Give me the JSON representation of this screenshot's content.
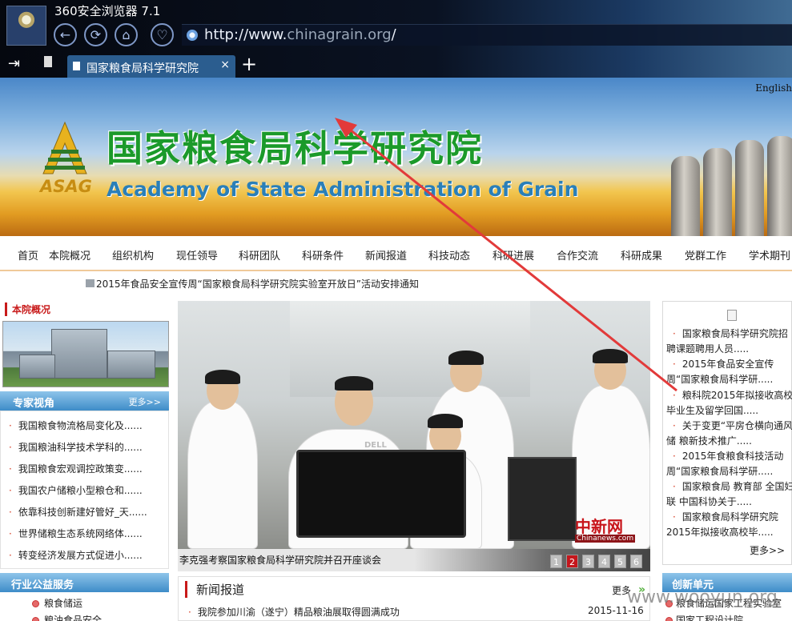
{
  "browser": {
    "app_title": "360安全浏览器 7.1",
    "url_prefix": "http://www.",
    "url_domain": "chinagrain.org",
    "url_suffix": "/",
    "tab_label": "国家粮食局科学研究院",
    "tab_close": "×",
    "new_tab": "+"
  },
  "banner": {
    "english_link": "English",
    "logo_text": "ASAG",
    "title": "国家粮食局科学研究院",
    "subtitle": "Academy of State Administration of Grain"
  },
  "nav": {
    "items": [
      "首页",
      "本院概况",
      "组织机构",
      "现任领导",
      "科研团队",
      "科研条件",
      "新闻报道",
      "科技动态",
      "科研进展",
      "合作交流",
      "科研成果",
      "党群工作",
      "学术期刊"
    ]
  },
  "notice": "2015年食品安全宣传周“国家粮食局科学研究院实验室开放日”活动安排通知",
  "left": {
    "intro_title": "本院概况",
    "experts_title": "专家视角",
    "experts_more": "更多>>",
    "experts": [
      "我国粮食物流格局变化及......",
      "我国粮油科学技术学科的......",
      "我国粮食宏观调控政策变......",
      "我国农户储粮小型粮仓和......",
      "依靠科技创新建好管好_天......",
      "世界储粮生态系统网络体......",
      "转变经济发展方式促进小......"
    ],
    "industry_title": "行业公益服务",
    "industry_items": [
      "粮食储运",
      "粮油食品安全"
    ]
  },
  "slide": {
    "caption": "李克强考察国家粮食局科学研究院并召开座谈会",
    "monitor_brand": "DELL",
    "source_logo": "中新网",
    "source_url": "Chinanews.com",
    "pages": [
      "1",
      "2",
      "3",
      "4",
      "5",
      "6"
    ],
    "active_page": 2
  },
  "news": {
    "title": "新闻报道",
    "more": "更多",
    "more_icon": "»",
    "items": [
      {
        "text": "我院参加川渝（遂宁）精品粮油展取得圆满成功",
        "date": "2015-11-16"
      }
    ]
  },
  "right": {
    "items": [
      "国家粮食局科学研究院招聘课题聘用人员.....",
      "2015年食品安全宣传周“国家粮食局科学研.....",
      "粮科院2015年拟接收高校毕业生及留学回国.....",
      "关于变更“平房仓横向通风储 粮新技术推广.....",
      "2015年食粮食科技活动周“国家粮食局科学研.....",
      "国家粮食局 教育部 全国妇联 中国科协关于.....",
      "国家粮食局科学研究院2015年拟接收高校毕....."
    ],
    "more": "更多>>",
    "innovation_title": "创新单元",
    "innovation_items": [
      "粮食储运国家工程实验室",
      "国家工程设计院"
    ]
  },
  "watermark": "www.wooyun.org",
  "colors": {
    "accent_red": "#c81a1a",
    "banner_green": "#1b9a2a",
    "section_blue": "#3e8cc8",
    "arrow_red": "#e23a3a"
  },
  "icons": [
    "back-icon",
    "refresh-icon",
    "home-icon",
    "heart-icon",
    "globe-icon",
    "document-icon",
    "close-icon",
    "plus-icon",
    "speech-bubble-icon",
    "broken-image-icon",
    "double-chevron-icon"
  ]
}
